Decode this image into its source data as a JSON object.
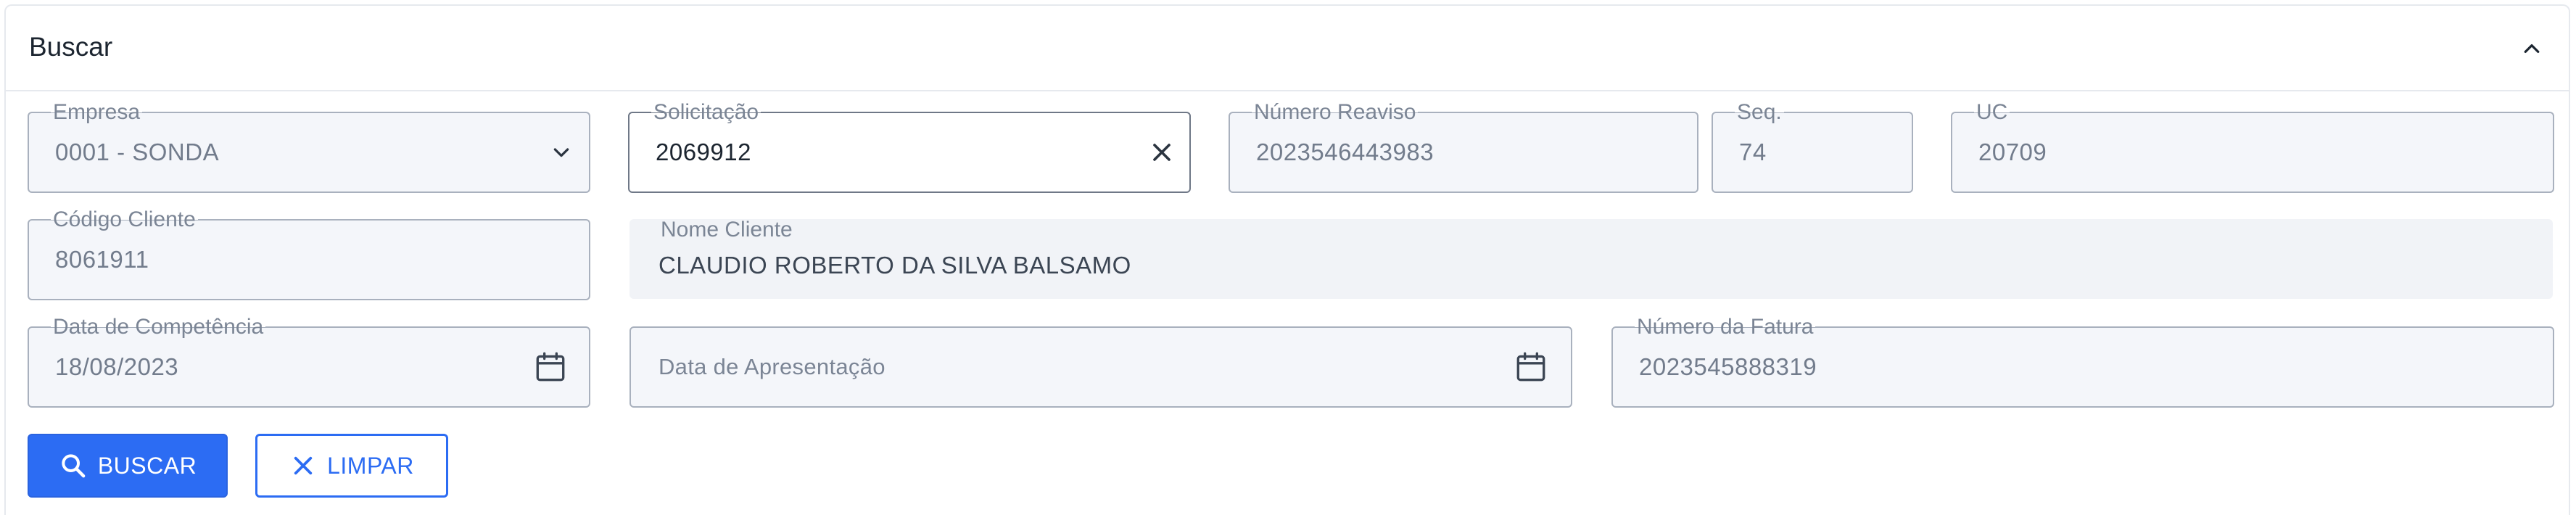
{
  "panel": {
    "title": "Buscar",
    "collapse_icon": "chevron-up-icon"
  },
  "fields": {
    "empresa": {
      "label": "Empresa",
      "value": "0001 - SONDA",
      "icon": "chevron-down-icon"
    },
    "solicitacao": {
      "label": "Solicitação",
      "value": "2069912",
      "icon": "close-icon"
    },
    "numero_reaviso": {
      "label": "Número Reaviso",
      "value": "2023546443983"
    },
    "seq": {
      "label": "Seq.",
      "value": "74"
    },
    "uc": {
      "label": "UC",
      "value": "20709"
    },
    "codigo_cliente": {
      "label": "Código Cliente",
      "value": "8061911"
    },
    "nome_cliente": {
      "label": "Nome Cliente",
      "value": "CLAUDIO ROBERTO DA SILVA BALSAMO"
    },
    "data_competencia": {
      "label": "Data de Competência",
      "value": "18/08/2023",
      "icon": "calendar-icon"
    },
    "data_apresentacao": {
      "placeholder": "Data de Apresentação",
      "icon": "calendar-icon"
    },
    "numero_fatura": {
      "label": "Número da Fatura",
      "value": "2023545888319"
    }
  },
  "buttons": {
    "buscar": {
      "label": "BUSCAR",
      "icon": "search-icon"
    },
    "limpar": {
      "label": "LIMPAR",
      "icon": "close-icon"
    }
  },
  "colors": {
    "primary": "#2c6cf3",
    "field_border": "#a9b1be",
    "field_bg": "#f4f6fa",
    "text_muted": "#727c8c"
  }
}
